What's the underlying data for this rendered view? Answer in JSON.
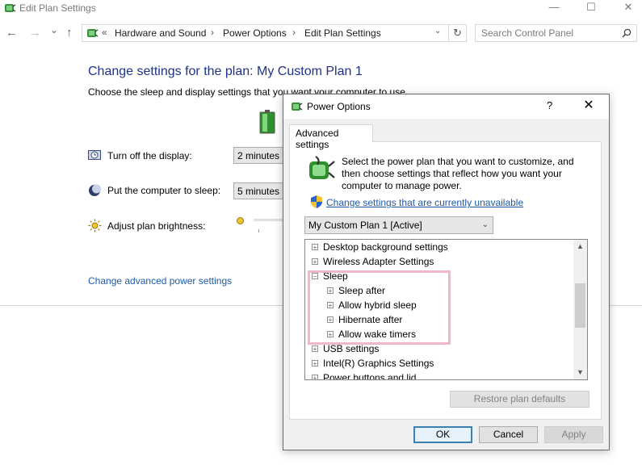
{
  "window": {
    "title": "Edit Plan Settings",
    "minimize": "—",
    "maximize": "☐",
    "close": "✕"
  },
  "nav": {
    "back": "←",
    "forward": "→",
    "recent": "⌄",
    "up": "↑",
    "breadcrumb_overflow": "«",
    "breadcrumbs": [
      "Hardware and Sound",
      "Power Options",
      "Edit Plan Settings"
    ],
    "separator": "›",
    "dropdown": "⌄",
    "refresh": "↻",
    "search_placeholder": "Search Control Panel"
  },
  "main": {
    "title": "Change settings for the plan: My Custom Plan 1",
    "subtitle": "Choose the sleep and display settings that you want your computer to use.",
    "display_label": "Turn off the display:",
    "display_value": "2 minutes",
    "sleep_label": "Put the computer to sleep:",
    "sleep_value": "5 minutes",
    "brightness_label": "Adjust plan brightness:",
    "advanced_link": "Change advanced power settings"
  },
  "dialog": {
    "title": "Power Options",
    "help": "?",
    "close": "✕",
    "tab": "Advanced settings",
    "description": "Select the power plan that you want to customize, and then choose settings that reflect how you want your computer to manage power.",
    "unavailable_link": "Change settings that are currently unavailable",
    "plan_selected": "My Custom Plan 1 [Active]",
    "tree": [
      {
        "label": "Desktop background settings",
        "expander": "+",
        "level": 0
      },
      {
        "label": "Wireless Adapter Settings",
        "expander": "+",
        "level": 0
      },
      {
        "label": "Sleep",
        "expander": "−",
        "level": 0
      },
      {
        "label": "Sleep after",
        "expander": "+",
        "level": 1
      },
      {
        "label": "Allow hybrid sleep",
        "expander": "+",
        "level": 1
      },
      {
        "label": "Hibernate after",
        "expander": "+",
        "level": 1
      },
      {
        "label": "Allow wake timers",
        "expander": "+",
        "level": 1
      },
      {
        "label": "USB settings",
        "expander": "+",
        "level": 0
      },
      {
        "label": "Intel(R) Graphics Settings",
        "expander": "+",
        "level": 0
      },
      {
        "label": "Power buttons and lid",
        "expander": "+",
        "level": 0
      }
    ],
    "scroll_up": "▲",
    "scroll_down": "▼",
    "restore_button": "Restore plan defaults",
    "ok_button": "OK",
    "cancel_button": "Cancel",
    "apply_button": "Apply"
  },
  "colors": {
    "title_blue": "#1e3287",
    "link_blue": "#1e5aa8",
    "highlight_pink": "#f0b6cc"
  }
}
